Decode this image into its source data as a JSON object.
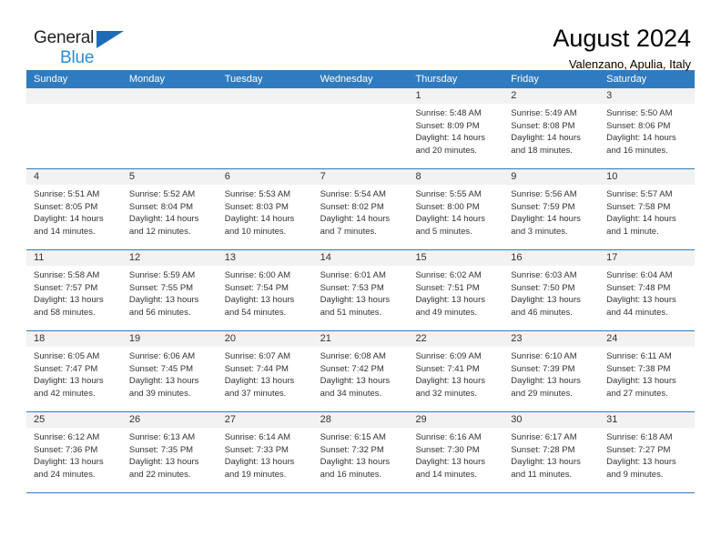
{
  "brand": {
    "name_part1": "General",
    "name_part2": "Blue",
    "triangle_color": "#1e6cb5",
    "blue_text_color": "#2b8bd4"
  },
  "header": {
    "title": "August 2024",
    "subtitle": "Valenzano, Apulia, Italy"
  },
  "theme": {
    "header_blue": "#2f7bbf",
    "day_band_gray": "#f2f2f2",
    "text_color": "#333333"
  },
  "weekdays": [
    "Sunday",
    "Monday",
    "Tuesday",
    "Wednesday",
    "Thursday",
    "Friday",
    "Saturday"
  ],
  "weeks": [
    [
      {
        "day": "",
        "sunrise": "",
        "sunset": "",
        "daylight_line1": "",
        "daylight_line2": ""
      },
      {
        "day": "",
        "sunrise": "",
        "sunset": "",
        "daylight_line1": "",
        "daylight_line2": ""
      },
      {
        "day": "",
        "sunrise": "",
        "sunset": "",
        "daylight_line1": "",
        "daylight_line2": ""
      },
      {
        "day": "",
        "sunrise": "",
        "sunset": "",
        "daylight_line1": "",
        "daylight_line2": ""
      },
      {
        "day": "1",
        "sunrise": "Sunrise: 5:48 AM",
        "sunset": "Sunset: 8:09 PM",
        "daylight_line1": "Daylight: 14 hours",
        "daylight_line2": "and 20 minutes."
      },
      {
        "day": "2",
        "sunrise": "Sunrise: 5:49 AM",
        "sunset": "Sunset: 8:08 PM",
        "daylight_line1": "Daylight: 14 hours",
        "daylight_line2": "and 18 minutes."
      },
      {
        "day": "3",
        "sunrise": "Sunrise: 5:50 AM",
        "sunset": "Sunset: 8:06 PM",
        "daylight_line1": "Daylight: 14 hours",
        "daylight_line2": "and 16 minutes."
      }
    ],
    [
      {
        "day": "4",
        "sunrise": "Sunrise: 5:51 AM",
        "sunset": "Sunset: 8:05 PM",
        "daylight_line1": "Daylight: 14 hours",
        "daylight_line2": "and 14 minutes."
      },
      {
        "day": "5",
        "sunrise": "Sunrise: 5:52 AM",
        "sunset": "Sunset: 8:04 PM",
        "daylight_line1": "Daylight: 14 hours",
        "daylight_line2": "and 12 minutes."
      },
      {
        "day": "6",
        "sunrise": "Sunrise: 5:53 AM",
        "sunset": "Sunset: 8:03 PM",
        "daylight_line1": "Daylight: 14 hours",
        "daylight_line2": "and 10 minutes."
      },
      {
        "day": "7",
        "sunrise": "Sunrise: 5:54 AM",
        "sunset": "Sunset: 8:02 PM",
        "daylight_line1": "Daylight: 14 hours",
        "daylight_line2": "and 7 minutes."
      },
      {
        "day": "8",
        "sunrise": "Sunrise: 5:55 AM",
        "sunset": "Sunset: 8:00 PM",
        "daylight_line1": "Daylight: 14 hours",
        "daylight_line2": "and 5 minutes."
      },
      {
        "day": "9",
        "sunrise": "Sunrise: 5:56 AM",
        "sunset": "Sunset: 7:59 PM",
        "daylight_line1": "Daylight: 14 hours",
        "daylight_line2": "and 3 minutes."
      },
      {
        "day": "10",
        "sunrise": "Sunrise: 5:57 AM",
        "sunset": "Sunset: 7:58 PM",
        "daylight_line1": "Daylight: 14 hours",
        "daylight_line2": "and 1 minute."
      }
    ],
    [
      {
        "day": "11",
        "sunrise": "Sunrise: 5:58 AM",
        "sunset": "Sunset: 7:57 PM",
        "daylight_line1": "Daylight: 13 hours",
        "daylight_line2": "and 58 minutes."
      },
      {
        "day": "12",
        "sunrise": "Sunrise: 5:59 AM",
        "sunset": "Sunset: 7:55 PM",
        "daylight_line1": "Daylight: 13 hours",
        "daylight_line2": "and 56 minutes."
      },
      {
        "day": "13",
        "sunrise": "Sunrise: 6:00 AM",
        "sunset": "Sunset: 7:54 PM",
        "daylight_line1": "Daylight: 13 hours",
        "daylight_line2": "and 54 minutes."
      },
      {
        "day": "14",
        "sunrise": "Sunrise: 6:01 AM",
        "sunset": "Sunset: 7:53 PM",
        "daylight_line1": "Daylight: 13 hours",
        "daylight_line2": "and 51 minutes."
      },
      {
        "day": "15",
        "sunrise": "Sunrise: 6:02 AM",
        "sunset": "Sunset: 7:51 PM",
        "daylight_line1": "Daylight: 13 hours",
        "daylight_line2": "and 49 minutes."
      },
      {
        "day": "16",
        "sunrise": "Sunrise: 6:03 AM",
        "sunset": "Sunset: 7:50 PM",
        "daylight_line1": "Daylight: 13 hours",
        "daylight_line2": "and 46 minutes."
      },
      {
        "day": "17",
        "sunrise": "Sunrise: 6:04 AM",
        "sunset": "Sunset: 7:48 PM",
        "daylight_line1": "Daylight: 13 hours",
        "daylight_line2": "and 44 minutes."
      }
    ],
    [
      {
        "day": "18",
        "sunrise": "Sunrise: 6:05 AM",
        "sunset": "Sunset: 7:47 PM",
        "daylight_line1": "Daylight: 13 hours",
        "daylight_line2": "and 42 minutes."
      },
      {
        "day": "19",
        "sunrise": "Sunrise: 6:06 AM",
        "sunset": "Sunset: 7:45 PM",
        "daylight_line1": "Daylight: 13 hours",
        "daylight_line2": "and 39 minutes."
      },
      {
        "day": "20",
        "sunrise": "Sunrise: 6:07 AM",
        "sunset": "Sunset: 7:44 PM",
        "daylight_line1": "Daylight: 13 hours",
        "daylight_line2": "and 37 minutes."
      },
      {
        "day": "21",
        "sunrise": "Sunrise: 6:08 AM",
        "sunset": "Sunset: 7:42 PM",
        "daylight_line1": "Daylight: 13 hours",
        "daylight_line2": "and 34 minutes."
      },
      {
        "day": "22",
        "sunrise": "Sunrise: 6:09 AM",
        "sunset": "Sunset: 7:41 PM",
        "daylight_line1": "Daylight: 13 hours",
        "daylight_line2": "and 32 minutes."
      },
      {
        "day": "23",
        "sunrise": "Sunrise: 6:10 AM",
        "sunset": "Sunset: 7:39 PM",
        "daylight_line1": "Daylight: 13 hours",
        "daylight_line2": "and 29 minutes."
      },
      {
        "day": "24",
        "sunrise": "Sunrise: 6:11 AM",
        "sunset": "Sunset: 7:38 PM",
        "daylight_line1": "Daylight: 13 hours",
        "daylight_line2": "and 27 minutes."
      }
    ],
    [
      {
        "day": "25",
        "sunrise": "Sunrise: 6:12 AM",
        "sunset": "Sunset: 7:36 PM",
        "daylight_line1": "Daylight: 13 hours",
        "daylight_line2": "and 24 minutes."
      },
      {
        "day": "26",
        "sunrise": "Sunrise: 6:13 AM",
        "sunset": "Sunset: 7:35 PM",
        "daylight_line1": "Daylight: 13 hours",
        "daylight_line2": "and 22 minutes."
      },
      {
        "day": "27",
        "sunrise": "Sunrise: 6:14 AM",
        "sunset": "Sunset: 7:33 PM",
        "daylight_line1": "Daylight: 13 hours",
        "daylight_line2": "and 19 minutes."
      },
      {
        "day": "28",
        "sunrise": "Sunrise: 6:15 AM",
        "sunset": "Sunset: 7:32 PM",
        "daylight_line1": "Daylight: 13 hours",
        "daylight_line2": "and 16 minutes."
      },
      {
        "day": "29",
        "sunrise": "Sunrise: 6:16 AM",
        "sunset": "Sunset: 7:30 PM",
        "daylight_line1": "Daylight: 13 hours",
        "daylight_line2": "and 14 minutes."
      },
      {
        "day": "30",
        "sunrise": "Sunrise: 6:17 AM",
        "sunset": "Sunset: 7:28 PM",
        "daylight_line1": "Daylight: 13 hours",
        "daylight_line2": "and 11 minutes."
      },
      {
        "day": "31",
        "sunrise": "Sunrise: 6:18 AM",
        "sunset": "Sunset: 7:27 PM",
        "daylight_line1": "Daylight: 13 hours",
        "daylight_line2": "and 9 minutes."
      }
    ]
  ]
}
